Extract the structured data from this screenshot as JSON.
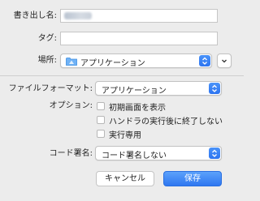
{
  "form": {
    "export_as_label": "書き出し名:",
    "tags_label": "タグ:",
    "tags_value": "",
    "where_label": "場所:",
    "where_value": "アプリケーション"
  },
  "format": {
    "label": "ファイルフォーマット:",
    "value": "アプリケーション"
  },
  "options": {
    "label": "オプション:",
    "items": [
      {
        "label": "初期画面を表示",
        "checked": false
      },
      {
        "label": "ハンドラの実行後に終了しない",
        "checked": false
      },
      {
        "label": "実行専用",
        "checked": false
      }
    ]
  },
  "signing": {
    "label": "コード署名:",
    "value": "コード署名しない"
  },
  "buttons": {
    "cancel": "キャンセル",
    "save": "保存"
  },
  "colors": {
    "accent": "#2f77f0",
    "folder_icon": "#5ea7f4",
    "background": "#ececec"
  }
}
